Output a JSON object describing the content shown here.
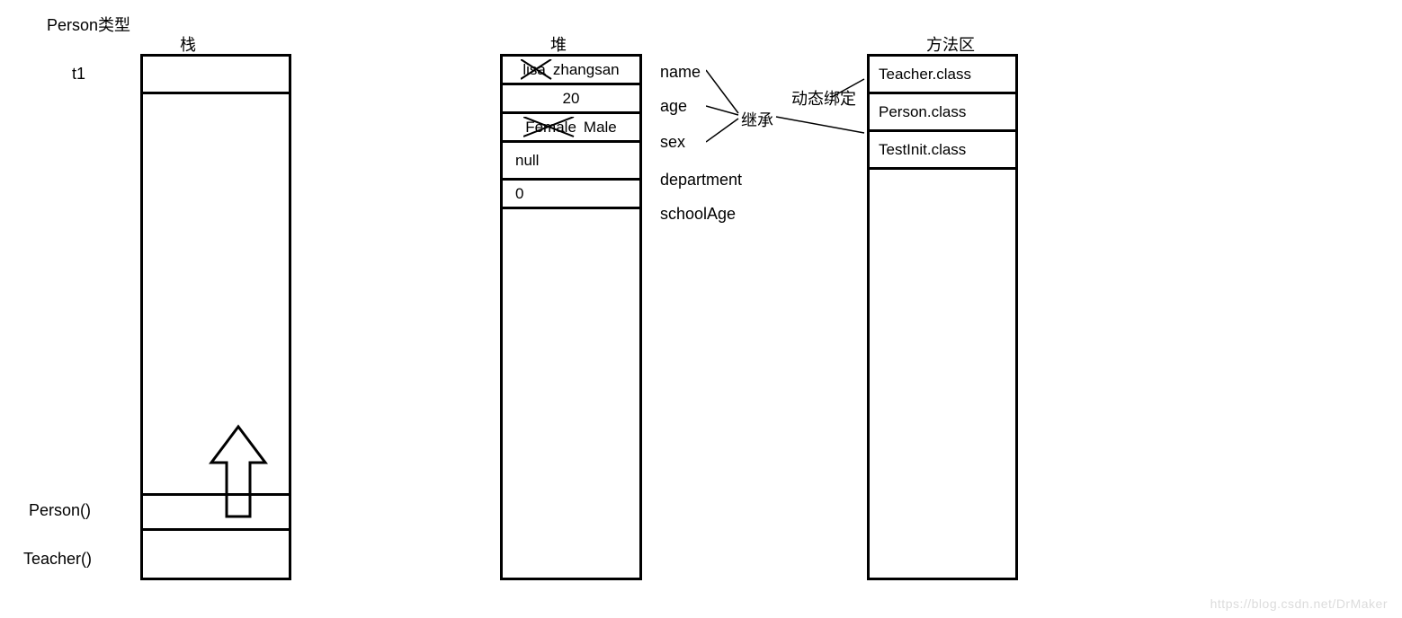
{
  "title": "Person类型",
  "stack": {
    "header": "栈",
    "var": "t1",
    "methods": [
      "Person()",
      "Teacher()"
    ]
  },
  "heap": {
    "header": "堆",
    "rows": [
      {
        "old": "lisa",
        "new": "zhangsan",
        "field": "name"
      },
      {
        "value": "20",
        "field": "age"
      },
      {
        "old": "Female",
        "new": "Male",
        "field": "sex"
      },
      {
        "value": "null",
        "field": "department"
      },
      {
        "value": "0",
        "field": "schoolAge"
      }
    ],
    "inheritLabel": "继承",
    "bindLabel": "动态绑定"
  },
  "methodArea": {
    "header": "方法区",
    "classes": [
      "Teacher.class",
      "Person.class",
      "TestInit.class"
    ]
  },
  "watermark": "https://blog.csdn.net/DrMaker"
}
